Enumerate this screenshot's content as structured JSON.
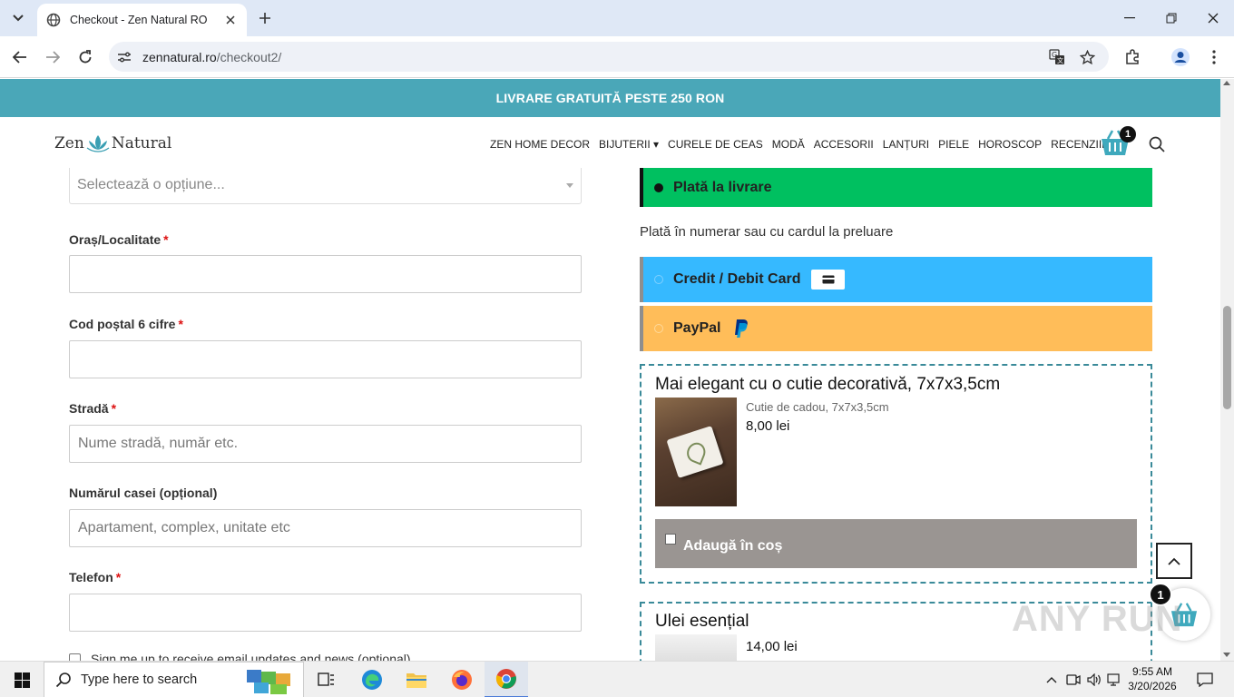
{
  "browser": {
    "tab_title": "Checkout - Zen Natural RO",
    "url_host": "zennatural.ro",
    "url_path": "/checkout2/"
  },
  "promo": {
    "text": "LIVRARE GRATUITĂ PESTE 250 RON"
  },
  "header": {
    "logo_left": "Zen",
    "logo_right": "Natural",
    "nav": [
      "ZEN HOME DECOR",
      "BIJUTERII ▾",
      "CURELE DE CEAS",
      "MODĂ",
      "ACCESORII",
      "LANȚURI",
      "PIELE",
      "HOROSCOP",
      "RECENZIILE"
    ],
    "cart_count": "1"
  },
  "form": {
    "select_placeholder": "Selectează o opțiune...",
    "city_label": "Oraș/Localitate",
    "postal_label": "Cod poștal 6 cifre",
    "street_label": "Stradă",
    "street_placeholder": "Nume stradă, număr etc.",
    "house_label": "Numărul casei (opțional)",
    "house_placeholder": "Apartament, complex, unitate etc",
    "phone_label": "Telefon",
    "required_mark": "*",
    "signup_text": "Sign me up to receive email updates and news (optional)"
  },
  "payment": {
    "cod_label": "Plată la livrare",
    "cod_desc": "Plată în numerar sau cu cardul la preluare",
    "card_label": "Credit / Debit Card",
    "paypal_label": "PayPal",
    "colors": {
      "cod": "#00c060",
      "card": "#36b9ff",
      "paypal": "#ffbd59"
    }
  },
  "upsell": [
    {
      "title": "Mai elegant cu o cutie decorativă, 7x7x3,5cm",
      "subtitle": "Cutie de cadou, 7x7x3,5cm",
      "price": "8,00 lei",
      "add_label": "Adaugă în coș"
    },
    {
      "title": "Ulei esențial",
      "price": "14,00 lei"
    }
  ],
  "floating_cart_count": "1",
  "watermark": "ANY RUN",
  "taskbar": {
    "search_placeholder": "Type here to search",
    "time": "9:55 AM",
    "date": "3/20/2026"
  }
}
